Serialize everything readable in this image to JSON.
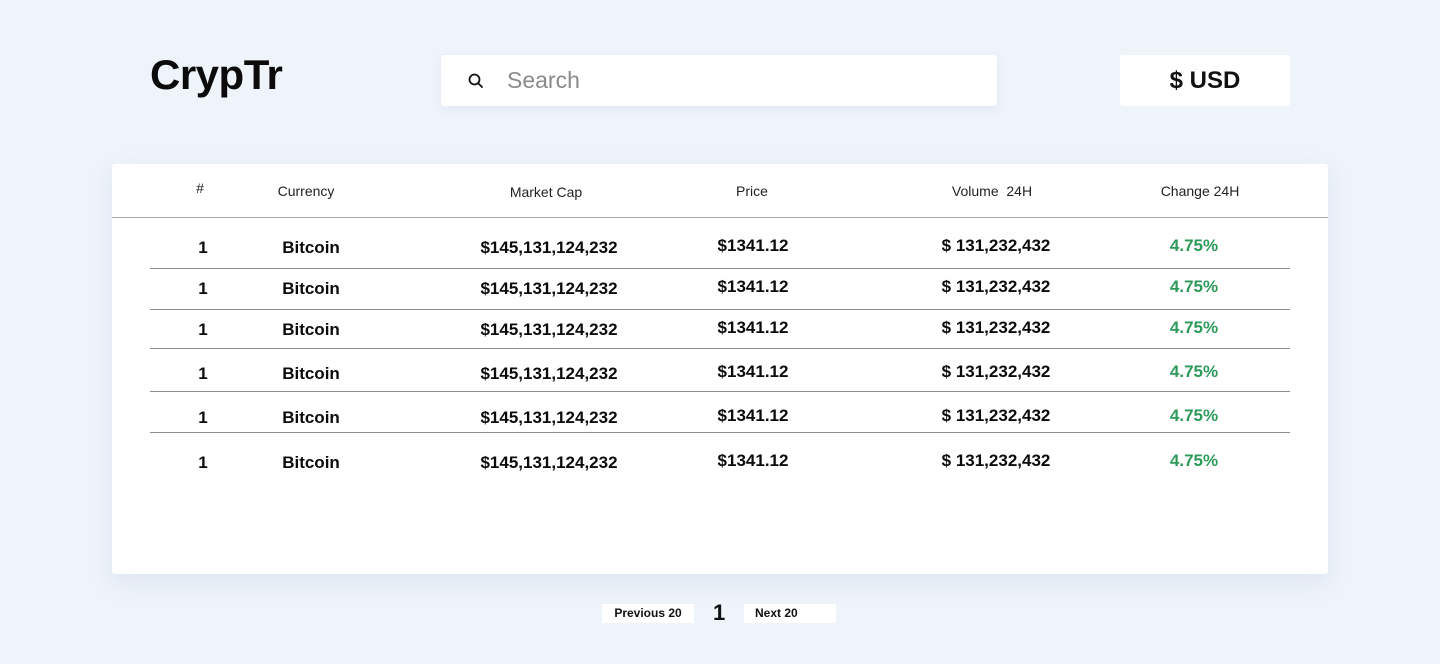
{
  "app": {
    "logo": "CrypTr"
  },
  "search": {
    "placeholder": "Search"
  },
  "currency": {
    "label": "$ USD"
  },
  "table": {
    "columns": [
      "#",
      "Currency",
      "Market Cap",
      "Price",
      "Volume  24H",
      "Change 24H"
    ],
    "rows": [
      {
        "rank": "1",
        "name": "Bitcoin",
        "market_cap": "$145,131,124,232",
        "price": "$1341.12",
        "volume": "$ 131,232,432",
        "change": "4.75%"
      },
      {
        "rank": "1",
        "name": "Bitcoin",
        "market_cap": "$145,131,124,232",
        "price": "$1341.12",
        "volume": "$ 131,232,432",
        "change": "4.75%"
      },
      {
        "rank": "1",
        "name": "Bitcoin",
        "market_cap": "$145,131,124,232",
        "price": "$1341.12",
        "volume": "$ 131,232,432",
        "change": "4.75%"
      },
      {
        "rank": "1",
        "name": "Bitcoin",
        "market_cap": "$145,131,124,232",
        "price": "$1341.12",
        "volume": "$ 131,232,432",
        "change": "4.75%"
      },
      {
        "rank": "1",
        "name": "Bitcoin",
        "market_cap": "$145,131,124,232",
        "price": "$1341.12",
        "volume": "$ 131,232,432",
        "change": "4.75%"
      },
      {
        "rank": "1",
        "name": "Bitcoin",
        "market_cap": "$145,131,124,232",
        "price": "$1341.12",
        "volume": "$ 131,232,432",
        "change": "4.75%"
      }
    ]
  },
  "pagination": {
    "prev_label": "Previous 20",
    "current_page": "1",
    "next_label": "Next 20"
  },
  "colors": {
    "background": "#eff4fb",
    "positive_change": "#2e9a5a"
  }
}
